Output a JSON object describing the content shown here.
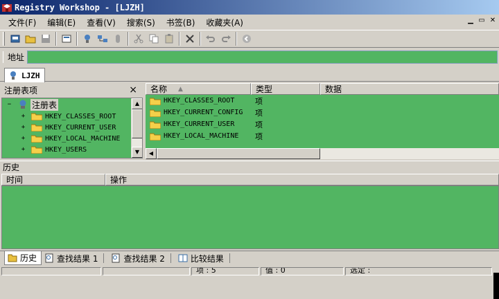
{
  "window": {
    "title": "Registry Workshop - [LJZH]"
  },
  "menu": {
    "items": [
      "文件(F)",
      "编辑(E)",
      "查看(V)",
      "搜索(S)",
      "书签(B)",
      "收藏夹(A)"
    ]
  },
  "address": {
    "label": "地址",
    "value": ""
  },
  "document_tab": {
    "label": "LJZH"
  },
  "tree": {
    "header": "注册表项",
    "close": "×",
    "root": "注册表",
    "expander_root": "−",
    "expander_child": "+",
    "items": [
      "HKEY_CLASSES_ROOT",
      "HKEY_CURRENT_USER",
      "HKEY_LOCAL_MACHINE",
      "HKEY_USERS"
    ]
  },
  "list": {
    "columns": {
      "name": "名称",
      "type": "类型",
      "data": "数据"
    },
    "rows": [
      {
        "name": "HKEY_CLASSES_ROOT",
        "type": "项"
      },
      {
        "name": "HKEY_CURRENT_CONFIG",
        "type": "项"
      },
      {
        "name": "HKEY_CURRENT_USER",
        "type": "项"
      },
      {
        "name": "HKEY_LOCAL_MACHINE",
        "type": "项"
      }
    ]
  },
  "history": {
    "label": "历史",
    "columns": {
      "time": "时间",
      "action": "操作"
    }
  },
  "bottom_tabs": [
    "历史",
    "查找结果 1",
    "查找结果 2",
    "比较结果"
  ],
  "status": {
    "items": "项 : 5",
    "values": "值 : 0",
    "selected": "选定 :"
  },
  "colors": {
    "pane_background": "#52b562",
    "title_gradient_start": "#0a246a",
    "title_gradient_end": "#a6caf0"
  },
  "icons": {
    "toolbar": [
      "connect-icon",
      "open-icon",
      "save-icon",
      "properties-icon",
      "registry-icon",
      "network-icon",
      "unload-icon",
      "cut-icon",
      "copy-icon",
      "paste-icon",
      "delete-icon",
      "undo-icon",
      "redo-icon",
      "go-icon"
    ]
  }
}
